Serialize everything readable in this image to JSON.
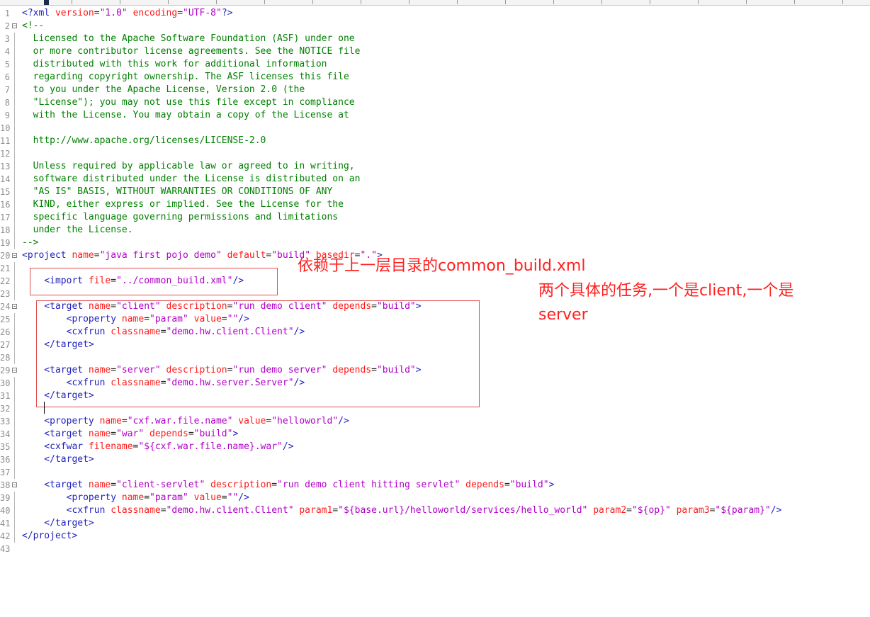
{
  "editor": {
    "lines": [
      {
        "n": "1",
        "fold": "",
        "tokens": [
          {
            "k": "t",
            "s": "<?xml "
          },
          {
            "k": "a",
            "s": "version"
          },
          {
            "k": "p",
            "s": "="
          },
          {
            "k": "v",
            "s": "\"1.0\""
          },
          {
            "k": "p",
            "s": " "
          },
          {
            "k": "a",
            "s": "encoding"
          },
          {
            "k": "p",
            "s": "="
          },
          {
            "k": "v",
            "s": "\"UTF-8\""
          },
          {
            "k": "t",
            "s": "?>"
          }
        ]
      },
      {
        "n": "2",
        "fold": "open",
        "tokens": [
          {
            "k": "c",
            "s": "<!--"
          }
        ]
      },
      {
        "n": "3",
        "fold": "bar",
        "tokens": [
          {
            "k": "c",
            "s": "  Licensed to the Apache Software Foundation (ASF) under one"
          }
        ]
      },
      {
        "n": "4",
        "fold": "bar",
        "tokens": [
          {
            "k": "c",
            "s": "  or more contributor license agreements. See the NOTICE file"
          }
        ]
      },
      {
        "n": "5",
        "fold": "bar",
        "tokens": [
          {
            "k": "c",
            "s": "  distributed with this work for additional information"
          }
        ]
      },
      {
        "n": "6",
        "fold": "bar",
        "tokens": [
          {
            "k": "c",
            "s": "  regarding copyright ownership. The ASF licenses this file"
          }
        ]
      },
      {
        "n": "7",
        "fold": "bar",
        "tokens": [
          {
            "k": "c",
            "s": "  to you under the Apache License, Version 2.0 (the"
          }
        ]
      },
      {
        "n": "8",
        "fold": "bar",
        "tokens": [
          {
            "k": "c",
            "s": "  \"License\"); you may not use this file except in compliance"
          }
        ]
      },
      {
        "n": "9",
        "fold": "bar",
        "tokens": [
          {
            "k": "c",
            "s": "  with the License. You may obtain a copy of the License at"
          }
        ]
      },
      {
        "n": "10",
        "fold": "bar",
        "tokens": []
      },
      {
        "n": "11",
        "fold": "bar",
        "tokens": [
          {
            "k": "c",
            "s": "  http://www.apache.org/licenses/LICENSE-2.0"
          }
        ]
      },
      {
        "n": "12",
        "fold": "bar",
        "tokens": []
      },
      {
        "n": "13",
        "fold": "bar",
        "tokens": [
          {
            "k": "c",
            "s": "  Unless required by applicable law or agreed to in writing,"
          }
        ]
      },
      {
        "n": "14",
        "fold": "bar",
        "tokens": [
          {
            "k": "c",
            "s": "  software distributed under the License is distributed on an"
          }
        ]
      },
      {
        "n": "15",
        "fold": "bar",
        "tokens": [
          {
            "k": "c",
            "s": "  \"AS IS\" BASIS, WITHOUT WARRANTIES OR CONDITIONS OF ANY"
          }
        ]
      },
      {
        "n": "16",
        "fold": "bar",
        "tokens": [
          {
            "k": "c",
            "s": "  KIND, either express or implied. See the License for the"
          }
        ]
      },
      {
        "n": "17",
        "fold": "bar",
        "tokens": [
          {
            "k": "c",
            "s": "  specific language governing permissions and limitations"
          }
        ]
      },
      {
        "n": "18",
        "fold": "bar",
        "tokens": [
          {
            "k": "c",
            "s": "  under the License."
          }
        ]
      },
      {
        "n": "19",
        "fold": "bar",
        "tokens": [
          {
            "k": "c",
            "s": "-->"
          }
        ]
      },
      {
        "n": "20",
        "fold": "open",
        "tokens": [
          {
            "k": "t",
            "s": "<project "
          },
          {
            "k": "a",
            "s": "name"
          },
          {
            "k": "p",
            "s": "="
          },
          {
            "k": "v",
            "s": "\"java first pojo demo\""
          },
          {
            "k": "p",
            "s": " "
          },
          {
            "k": "a",
            "s": "default"
          },
          {
            "k": "p",
            "s": "="
          },
          {
            "k": "v",
            "s": "\"build\""
          },
          {
            "k": "p",
            "s": " "
          },
          {
            "k": "a",
            "s": "basedir"
          },
          {
            "k": "p",
            "s": "="
          },
          {
            "k": "v",
            "s": "\".\""
          },
          {
            "k": "t",
            "s": ">"
          }
        ]
      },
      {
        "n": "21",
        "fold": "bar",
        "tokens": []
      },
      {
        "n": "22",
        "fold": "bar",
        "tokens": [
          {
            "k": "t",
            "s": "    <import "
          },
          {
            "k": "a",
            "s": "file"
          },
          {
            "k": "p",
            "s": "="
          },
          {
            "k": "v",
            "s": "\"../common_build.xml\""
          },
          {
            "k": "t",
            "s": "/>"
          }
        ]
      },
      {
        "n": "23",
        "fold": "bar",
        "tokens": []
      },
      {
        "n": "24",
        "fold": "open",
        "tokens": [
          {
            "k": "t",
            "s": "    <target "
          },
          {
            "k": "a",
            "s": "name"
          },
          {
            "k": "p",
            "s": "="
          },
          {
            "k": "v",
            "s": "\"client\""
          },
          {
            "k": "p",
            "s": " "
          },
          {
            "k": "a",
            "s": "description"
          },
          {
            "k": "p",
            "s": "="
          },
          {
            "k": "v",
            "s": "\"run demo client\""
          },
          {
            "k": "p",
            "s": " "
          },
          {
            "k": "a",
            "s": "depends"
          },
          {
            "k": "p",
            "s": "="
          },
          {
            "k": "v",
            "s": "\"build\""
          },
          {
            "k": "t",
            "s": ">"
          }
        ]
      },
      {
        "n": "25",
        "fold": "bar",
        "tokens": [
          {
            "k": "t",
            "s": "        <property "
          },
          {
            "k": "a",
            "s": "name"
          },
          {
            "k": "p",
            "s": "="
          },
          {
            "k": "v",
            "s": "\"param\""
          },
          {
            "k": "p",
            "s": " "
          },
          {
            "k": "a",
            "s": "value"
          },
          {
            "k": "p",
            "s": "="
          },
          {
            "k": "v",
            "s": "\"\""
          },
          {
            "k": "t",
            "s": "/>"
          }
        ]
      },
      {
        "n": "26",
        "fold": "bar",
        "tokens": [
          {
            "k": "t",
            "s": "        <cxfrun "
          },
          {
            "k": "a",
            "s": "classname"
          },
          {
            "k": "p",
            "s": "="
          },
          {
            "k": "v",
            "s": "\"demo.hw.client.Client\""
          },
          {
            "k": "t",
            "s": "/>"
          }
        ]
      },
      {
        "n": "27",
        "fold": "bar",
        "tokens": [
          {
            "k": "t",
            "s": "    </target>"
          }
        ]
      },
      {
        "n": "28",
        "fold": "bar",
        "tokens": []
      },
      {
        "n": "29",
        "fold": "open",
        "tokens": [
          {
            "k": "t",
            "s": "    <target "
          },
          {
            "k": "a",
            "s": "name"
          },
          {
            "k": "p",
            "s": "="
          },
          {
            "k": "v",
            "s": "\"server\""
          },
          {
            "k": "p",
            "s": " "
          },
          {
            "k": "a",
            "s": "description"
          },
          {
            "k": "p",
            "s": "="
          },
          {
            "k": "v",
            "s": "\"run demo server\""
          },
          {
            "k": "p",
            "s": " "
          },
          {
            "k": "a",
            "s": "depends"
          },
          {
            "k": "p",
            "s": "="
          },
          {
            "k": "v",
            "s": "\"build\""
          },
          {
            "k": "t",
            "s": ">"
          }
        ]
      },
      {
        "n": "30",
        "fold": "bar",
        "tokens": [
          {
            "k": "t",
            "s": "        <cxfrun "
          },
          {
            "k": "a",
            "s": "classname"
          },
          {
            "k": "p",
            "s": "="
          },
          {
            "k": "v",
            "s": "\"demo.hw.server.Server\""
          },
          {
            "k": "t",
            "s": "/>"
          }
        ]
      },
      {
        "n": "31",
        "fold": "bar",
        "tokens": [
          {
            "k": "t",
            "s": "    </target>"
          }
        ]
      },
      {
        "n": "32",
        "fold": "bar",
        "tokens": []
      },
      {
        "n": "33",
        "fold": "bar",
        "tokens": [
          {
            "k": "t",
            "s": "    <property "
          },
          {
            "k": "a",
            "s": "name"
          },
          {
            "k": "p",
            "s": "="
          },
          {
            "k": "v",
            "s": "\"cxf.war.file.name\""
          },
          {
            "k": "p",
            "s": " "
          },
          {
            "k": "a",
            "s": "value"
          },
          {
            "k": "p",
            "s": "="
          },
          {
            "k": "v",
            "s": "\"helloworld\""
          },
          {
            "k": "t",
            "s": "/>"
          }
        ]
      },
      {
        "n": "34",
        "fold": "bar",
        "tokens": [
          {
            "k": "t",
            "s": "    <target "
          },
          {
            "k": "a",
            "s": "name"
          },
          {
            "k": "p",
            "s": "="
          },
          {
            "k": "v",
            "s": "\"war\""
          },
          {
            "k": "p",
            "s": " "
          },
          {
            "k": "a",
            "s": "depends"
          },
          {
            "k": "p",
            "s": "="
          },
          {
            "k": "v",
            "s": "\"build\""
          },
          {
            "k": "t",
            "s": ">"
          }
        ]
      },
      {
        "n": "35",
        "fold": "bar",
        "tokens": [
          {
            "k": "t",
            "s": "    <cxfwar "
          },
          {
            "k": "a",
            "s": "filename"
          },
          {
            "k": "p",
            "s": "="
          },
          {
            "k": "v",
            "s": "\"${cxf.war.file.name}.war\""
          },
          {
            "k": "t",
            "s": "/>"
          }
        ]
      },
      {
        "n": "36",
        "fold": "bar",
        "tokens": [
          {
            "k": "t",
            "s": "    </target>"
          }
        ]
      },
      {
        "n": "37",
        "fold": "bar",
        "tokens": []
      },
      {
        "n": "38",
        "fold": "open",
        "tokens": [
          {
            "k": "t",
            "s": "    <target "
          },
          {
            "k": "a",
            "s": "name"
          },
          {
            "k": "p",
            "s": "="
          },
          {
            "k": "v",
            "s": "\"client-servlet\""
          },
          {
            "k": "p",
            "s": " "
          },
          {
            "k": "a",
            "s": "description"
          },
          {
            "k": "p",
            "s": "="
          },
          {
            "k": "v",
            "s": "\"run demo client hitting servlet\""
          },
          {
            "k": "p",
            "s": " "
          },
          {
            "k": "a",
            "s": "depends"
          },
          {
            "k": "p",
            "s": "="
          },
          {
            "k": "v",
            "s": "\"build\""
          },
          {
            "k": "t",
            "s": ">"
          }
        ]
      },
      {
        "n": "39",
        "fold": "bar",
        "tokens": [
          {
            "k": "t",
            "s": "        <property "
          },
          {
            "k": "a",
            "s": "name"
          },
          {
            "k": "p",
            "s": "="
          },
          {
            "k": "v",
            "s": "\"param\""
          },
          {
            "k": "p",
            "s": " "
          },
          {
            "k": "a",
            "s": "value"
          },
          {
            "k": "p",
            "s": "="
          },
          {
            "k": "v",
            "s": "\"\""
          },
          {
            "k": "t",
            "s": "/>"
          }
        ]
      },
      {
        "n": "40",
        "fold": "bar",
        "tokens": [
          {
            "k": "t",
            "s": "        <cxfrun "
          },
          {
            "k": "a",
            "s": "classname"
          },
          {
            "k": "p",
            "s": "="
          },
          {
            "k": "v",
            "s": "\"demo.hw.client.Client\""
          },
          {
            "k": "p",
            "s": " "
          },
          {
            "k": "a",
            "s": "param1"
          },
          {
            "k": "p",
            "s": "="
          },
          {
            "k": "v",
            "s": "\"${base.url}/helloworld/services/hello_world\""
          },
          {
            "k": "p",
            "s": " "
          },
          {
            "k": "a",
            "s": "param2"
          },
          {
            "k": "p",
            "s": "="
          },
          {
            "k": "v",
            "s": "\"${op}\""
          },
          {
            "k": "p",
            "s": " "
          },
          {
            "k": "a",
            "s": "param3"
          },
          {
            "k": "p",
            "s": "="
          },
          {
            "k": "v",
            "s": "\"${param}\""
          },
          {
            "k": "t",
            "s": "/>"
          }
        ]
      },
      {
        "n": "41",
        "fold": "bar",
        "tokens": [
          {
            "k": "t",
            "s": "    </target>"
          }
        ]
      },
      {
        "n": "42",
        "fold": "bar",
        "tokens": [
          {
            "k": "t",
            "s": "</project>"
          }
        ]
      },
      {
        "n": "43",
        "fold": "",
        "tokens": []
      }
    ]
  },
  "annotations": {
    "import_note": "依赖于上一层目录的common_build.xml",
    "targets_note_line1": "两个具体的任务,一个是client,一个是",
    "targets_note_line2": "server"
  },
  "colors": {
    "tag": "#1f1fbf",
    "attribute": "#ff1a1a",
    "value": "#b000c8",
    "comment": "#008000",
    "annotation": "#ff2020"
  }
}
